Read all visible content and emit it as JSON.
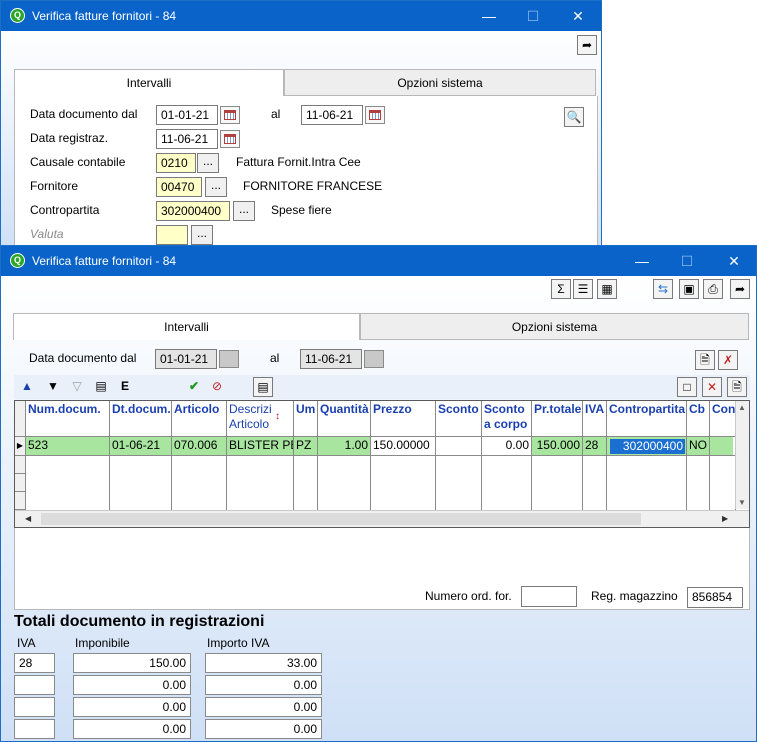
{
  "window_back": {
    "title": "Verifica fatture fornitori - 84",
    "tabs": [
      "Intervalli",
      "Opzioni sistema"
    ],
    "labels": {
      "data_doc": "Data documento dal",
      "al": "al",
      "data_reg": "Data registraz.",
      "causale": "Causale contabile",
      "fornitore": "Fornitore",
      "contropartita": "Contropartita",
      "valuta": "Valuta"
    },
    "values": {
      "data_dal": "01-01-21",
      "data_al": "11-06-21",
      "data_reg": "11-06-21",
      "causale_code": "0210",
      "causale_desc": "Fattura Fornit.Intra Cee",
      "fornitore_code": "00470",
      "fornitore_desc": "FORNITORE FRANCESE",
      "contropartita_code": "302000400",
      "contropartita_desc": "Spese fiere",
      "valuta_code": ""
    },
    "dots_label": "..."
  },
  "window_front": {
    "title": "Verifica fatture fornitori - 84",
    "tabs": [
      "Intervalli",
      "Opzioni sistema"
    ],
    "labels": {
      "data_doc": "Data documento dal",
      "al": "al"
    },
    "values": {
      "data_dal": "01-01-21",
      "data_al": "11-06-21"
    },
    "toolbar_icons": [
      "sum-icon",
      "list-icon",
      "grid-calc-icon",
      "swap-icon",
      "save-icon",
      "print-icon",
      "exit-icon"
    ],
    "grid_toolbar": [
      "arrow-up-icon",
      "filter-icon",
      "filter-off-icon",
      "columns-icon",
      "excel-export-icon",
      "confirm-icon",
      "cancel-icon",
      "window-icon"
    ],
    "grid": {
      "columns": [
        "Num.docum.",
        "Dt.docum.",
        "Articolo",
        "Descrizi Articolo",
        "Um",
        "Quantità",
        "Prezzo",
        "Sconto",
        "Sconto a corpo",
        "Pr.totale",
        "IVA",
        "Contropartita",
        "Cb",
        "Con"
      ],
      "rows": [
        [
          "523",
          "01-06-21",
          "070.006",
          "BLISTER PE",
          "PZ",
          "1.00",
          "150.00000",
          "",
          "0.00",
          "150.000",
          "28",
          "302000400",
          "NO",
          ""
        ]
      ]
    },
    "footer": {
      "numero_ord_label": "Numero ord. for.",
      "numero_ord_value": "",
      "reg_magazzino_label": "Reg. magazzino",
      "reg_magazzino_value": "856854"
    },
    "totals": {
      "title": "Totali documento in registrazioni",
      "headers": [
        "IVA",
        "Imponibile",
        "Importo IVA"
      ],
      "rows": [
        [
          "28",
          "150.00",
          "33.00"
        ],
        [
          "",
          "0.00",
          "0.00"
        ],
        [
          "",
          "0.00",
          "0.00"
        ],
        [
          "",
          "0.00",
          "0.00"
        ]
      ]
    }
  },
  "colors": {
    "titlebar": "#0a63c8",
    "row_highlight": "#a8e6a0",
    "field_yellow": "#ffffc8",
    "header_text": "#1a3fb0"
  }
}
